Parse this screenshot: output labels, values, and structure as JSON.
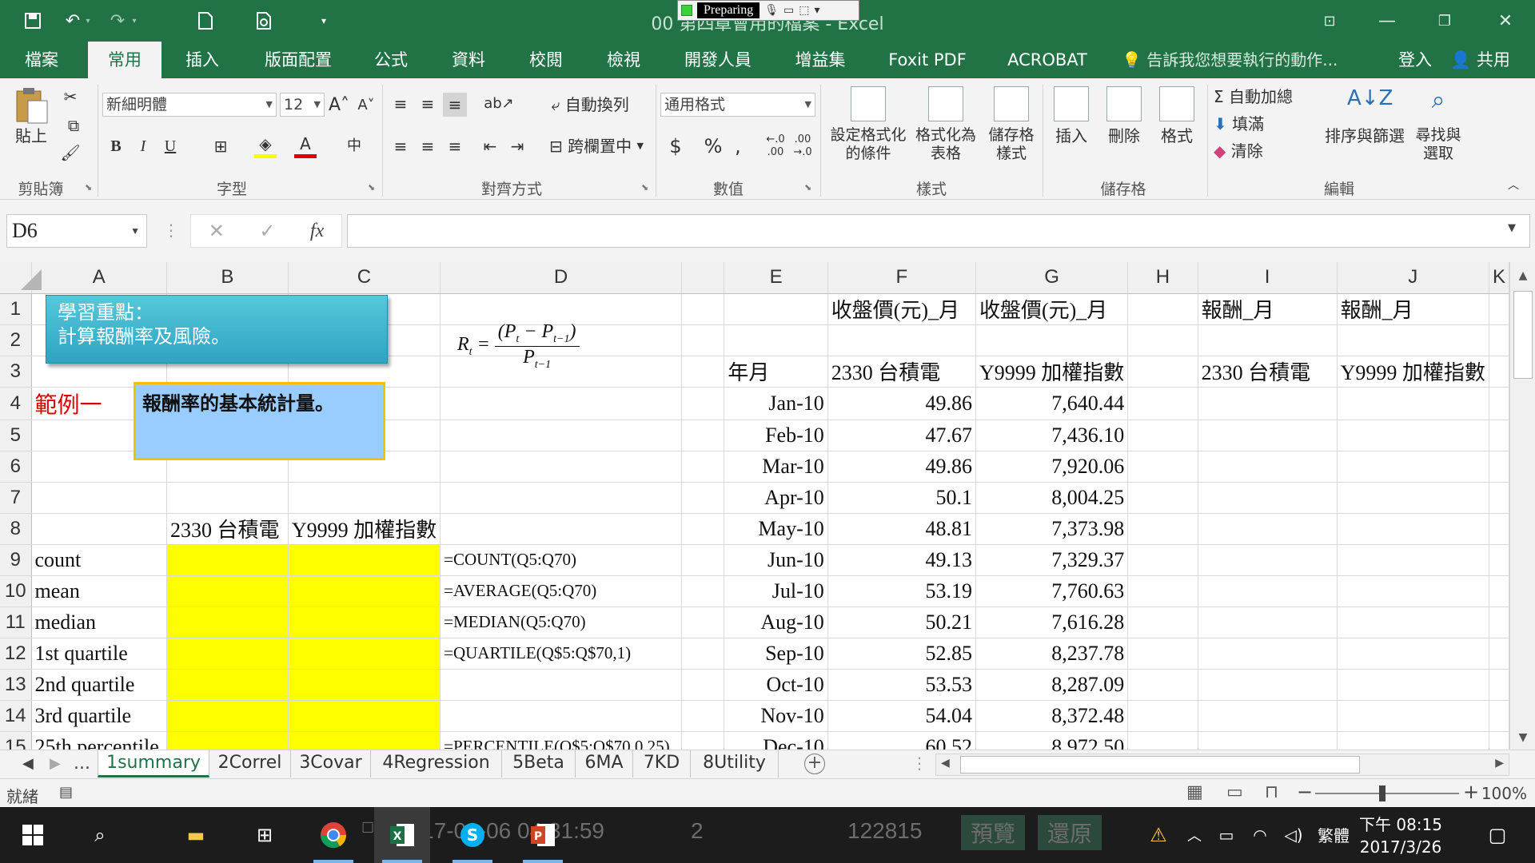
{
  "window": {
    "title": "00 第四章會用的檔案 - Excel",
    "recorder_status": "Preparing"
  },
  "ribbon_tabs": [
    "檔案",
    "常用",
    "插入",
    "版面配置",
    "公式",
    "資料",
    "校閱",
    "檢視",
    "開發人員",
    "增益集",
    "Foxit PDF",
    "ACROBAT"
  ],
  "active_tab": "常用",
  "tell_me": "告訴我您想要執行的動作...",
  "sign_in": "登入",
  "share": "共用",
  "ribbon": {
    "clipboard": {
      "paste": "貼上",
      "label": "剪貼簿"
    },
    "font": {
      "name": "新細明體",
      "size": "12",
      "label": "字型",
      "bold": "B",
      "italic": "I",
      "underline": "U"
    },
    "alignment": {
      "wrap": "自動換列",
      "merge": "跨欄置中",
      "label": "對齊方式"
    },
    "number": {
      "format": "通用格式",
      "label": "數值"
    },
    "styles": {
      "cond": "設定格式化的條件",
      "table": "格式化為表格",
      "cell": "儲存格樣式",
      "label": "樣式"
    },
    "cells": {
      "insert": "插入",
      "delete": "刪除",
      "format": "格式",
      "label": "儲存格"
    },
    "editing": {
      "autosum": "自動加總",
      "fill": "填滿",
      "clear": "清除",
      "sort": "排序與篩選",
      "find": "尋找與選取",
      "label": "編輯"
    }
  },
  "formula_bar": {
    "name_box": "D6",
    "formula": ""
  },
  "columns": [
    "A",
    "B",
    "C",
    "D",
    "E",
    "F",
    "G",
    "H",
    "I",
    "J",
    "K"
  ],
  "rows": [
    "1",
    "2",
    "3",
    "4",
    "5",
    "6",
    "7",
    "8",
    "9",
    "10",
    "11",
    "12",
    "13",
    "14",
    "15"
  ],
  "cells": {
    "F1": "收盤價(元)_月",
    "G1": "收盤價(元)_月",
    "I1": "報酬_月",
    "J1": "報酬_月",
    "E3": "年月",
    "F3": "2330 台積電",
    "G3": "Y9999 加權指數",
    "I3": "2330 台積電",
    "J3": "Y9999 加權指數",
    "A4": "範例一",
    "B8": "2330 台積電",
    "C8": "Y9999 加權指數",
    "A9": "count",
    "A10": "mean",
    "A11": "median",
    "A12": "1st quartile",
    "A13": "2nd quartile",
    "A14": "3rd quartile",
    "A15": "25th percentile",
    "D9": "=COUNT(Q5:Q70)",
    "D10": "=AVERAGE(Q5:Q70)",
    "D11": "=MEDIAN(Q5:Q70)",
    "D12": "=QUARTILE(Q$5:Q$70,1)",
    "D15": "=PERCENTILE(Q$5:Q$70,0.25)"
  },
  "price_series": [
    {
      "month": "Jan-10",
      "tsmc": "49.86",
      "taiex": "7,640.44"
    },
    {
      "month": "Feb-10",
      "tsmc": "47.67",
      "taiex": "7,436.10"
    },
    {
      "month": "Mar-10",
      "tsmc": "49.86",
      "taiex": "7,920.06"
    },
    {
      "month": "Apr-10",
      "tsmc": "50.1",
      "taiex": "8,004.25"
    },
    {
      "month": "May-10",
      "tsmc": "48.81",
      "taiex": "7,373.98"
    },
    {
      "month": "Jun-10",
      "tsmc": "49.13",
      "taiex": "7,329.37"
    },
    {
      "month": "Jul-10",
      "tsmc": "53.19",
      "taiex": "7,760.63"
    },
    {
      "month": "Aug-10",
      "tsmc": "50.21",
      "taiex": "7,616.28"
    },
    {
      "month": "Sep-10",
      "tsmc": "52.85",
      "taiex": "8,237.78"
    },
    {
      "month": "Oct-10",
      "tsmc": "53.53",
      "taiex": "8,287.09"
    },
    {
      "month": "Nov-10",
      "tsmc": "54.04",
      "taiex": "8,372.48"
    },
    {
      "month": "Dec-10",
      "tsmc": "60.52",
      "taiex": "8,972.50"
    }
  ],
  "callouts": {
    "learning_title": "學習重點：",
    "learning_body": "計算報酬率及風險。",
    "example_box": "報酬率的基本統計量。"
  },
  "sheet_tabs": [
    "1summary",
    "2Correl",
    "3Covar",
    "4Regression",
    "5Beta",
    "6MA",
    "7KD",
    "8Utility"
  ],
  "active_sheet": "1summary",
  "status": {
    "ready": "就緒",
    "zoom": "100%"
  },
  "taskbar": {
    "ime": "繁體",
    "time": "下午 08:15",
    "date": "2017/3/26",
    "background_text": "2017-03-06 04:31:59",
    "background_num1": "2",
    "background_num2": "122815",
    "background_btn1": "預覽",
    "background_btn2": "還原"
  },
  "colors": {
    "excel_green": "#217346",
    "highlight_yellow": "#ffff00",
    "callout_blue": "#99ccff",
    "callout_teal": "#2ea4c3",
    "red_text": "#e00000"
  }
}
